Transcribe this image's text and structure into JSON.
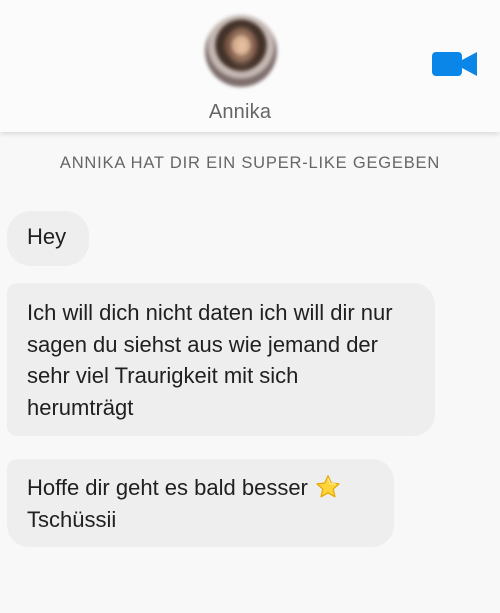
{
  "header": {
    "contact_name": "Annika",
    "video_icon": "video-camera-icon",
    "accent_color": "#0a86e8"
  },
  "conversation": {
    "super_like_notice": "ANNIKA HAT DIR EIN SUPER-LIKE GEGEBEN",
    "messages": [
      {
        "lines": [
          "Hey"
        ]
      },
      {
        "lines": [
          "Ich will dich nicht daten ich will dir nur",
          "sagen du siehst aus wie jemand der",
          "sehr viel Traurigkeit mit sich",
          "herumträgt"
        ]
      },
      {
        "lines": [
          "Hoffe dir geht es bald besser",
          "Tschüssii"
        ],
        "emoji_icon": "star-icon"
      }
    ]
  }
}
